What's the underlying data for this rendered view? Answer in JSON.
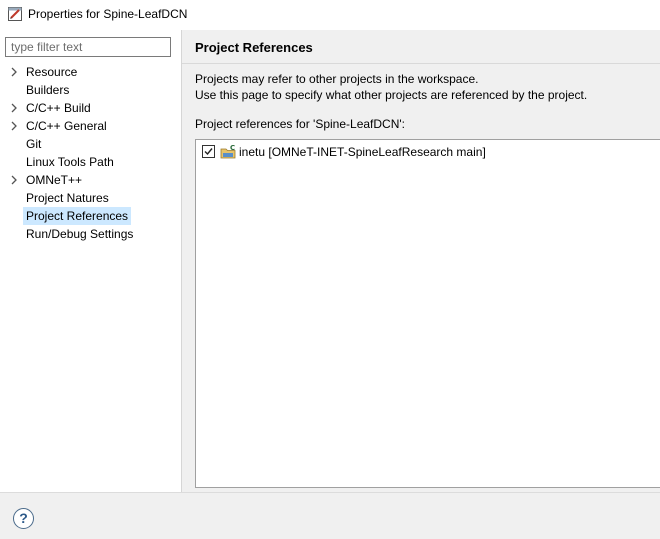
{
  "window": {
    "title": "Properties for Spine-LeafDCN"
  },
  "filter": {
    "placeholder": "type filter text",
    "value": ""
  },
  "tree": {
    "items": [
      {
        "label": "Resource",
        "expandable": true,
        "selected": false
      },
      {
        "label": "Builders",
        "expandable": false,
        "selected": false
      },
      {
        "label": "C/C++ Build",
        "expandable": true,
        "selected": false
      },
      {
        "label": "C/C++ General",
        "expandable": true,
        "selected": false
      },
      {
        "label": "Git",
        "expandable": false,
        "selected": false
      },
      {
        "label": "Linux Tools Path",
        "expandable": false,
        "selected": false
      },
      {
        "label": "OMNeT++",
        "expandable": true,
        "selected": false
      },
      {
        "label": "Project Natures",
        "expandable": false,
        "selected": false
      },
      {
        "label": "Project References",
        "expandable": false,
        "selected": true
      },
      {
        "label": "Run/Debug Settings",
        "expandable": false,
        "selected": false
      }
    ]
  },
  "page": {
    "title": "Project References",
    "description_line1": "Projects may refer to other projects in the workspace.",
    "description_line2": "Use this page to specify what other projects are referenced by the project.",
    "references_label": "Project references for 'Spine-LeafDCN':",
    "references": [
      {
        "label": "inetu [OMNeT-INET-SpineLeafResearch main]",
        "checked": true,
        "icon": "project-folder-icon"
      }
    ]
  },
  "colors": {
    "selection": "#cce8ff",
    "panel_bg": "#f0f0f0"
  },
  "footer": {
    "help_icon": "help-icon"
  }
}
